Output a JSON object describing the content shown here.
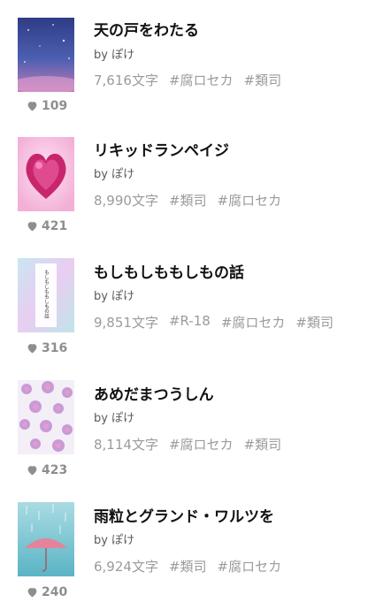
{
  "works": [
    {
      "title": "天の戸をわたる",
      "author": "by ぽけ",
      "chars": "7,616文字",
      "tags": [
        "#腐ロセカ",
        "#類司"
      ],
      "likes": "109",
      "cover_colors": [
        "#2c4f96",
        "#6b4fae",
        "#c979b7"
      ]
    },
    {
      "title": "リキッドランペイジ",
      "author": "by ぽけ",
      "chars": "8,990文字",
      "tags": [
        "#類司",
        "#腐ロセカ"
      ],
      "likes": "421",
      "cover_colors": [
        "#f2d3e6",
        "#d23b7e",
        "#8c1f4d"
      ]
    },
    {
      "title": "もしもしももしもの話",
      "author": "by ぽけ",
      "chars": "9,851文字",
      "tags": [
        "#R-18",
        "#腐ロセカ",
        "#類司"
      ],
      "likes": "316",
      "cover_colors": [
        "#bfe3ee",
        "#e6c1ef",
        "#ffffff"
      ],
      "cover_text": "もしもしももしもの話"
    },
    {
      "title": "あめだまつうしん",
      "author": "by ぽけ",
      "chars": "8,114文字",
      "tags": [
        "#腐ロセカ",
        "#類司"
      ],
      "likes": "423",
      "cover_colors": [
        "#f7f0f8",
        "#c79bd8",
        "#e39ac3"
      ]
    },
    {
      "title": "雨粒とグランド・ワルツを",
      "author": "by ぽけ",
      "chars": "6,924文字",
      "tags": [
        "#類司",
        "#腐ロセカ"
      ],
      "likes": "240",
      "cover_colors": [
        "#9fd6df",
        "#5bb7c6",
        "#e3849b"
      ]
    }
  ],
  "ui": {
    "heart_color": "#8e8e8e",
    "icon": "heart-icon"
  }
}
